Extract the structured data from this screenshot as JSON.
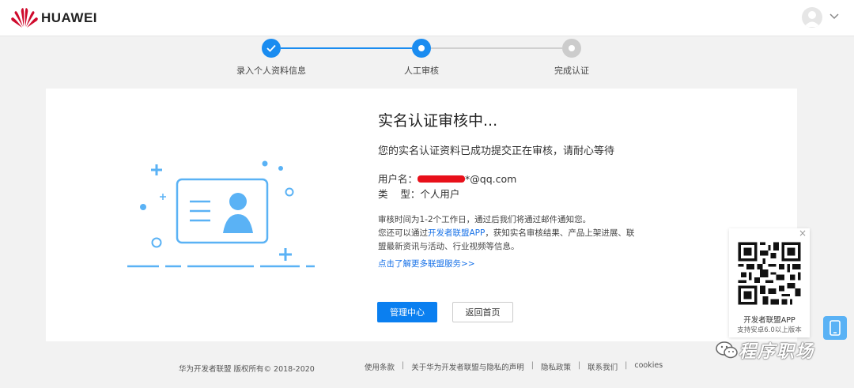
{
  "brand": {
    "name": "HUAWEI",
    "color": "#cf0a2c"
  },
  "header": {
    "user_avatar_icon": "user-avatar-icon",
    "menu_icon": "chevron-down-icon"
  },
  "steps": [
    {
      "label": "录入个人资料信息",
      "status": "done"
    },
    {
      "label": "人工审核",
      "status": "current"
    },
    {
      "label": "完成认证",
      "status": "pending"
    }
  ],
  "colors": {
    "accent": "#0a7ff0",
    "step_active": "#1a8cf0",
    "step_pending": "#cccccc",
    "link": "#1a73e8"
  },
  "review": {
    "title": "实名认证审核中...",
    "subtitle": "您的实名认证资料已成功提交正在审核，请耐心等待",
    "username_label": "用户名：",
    "username_suffix": "*@qq.com",
    "type_label": "类    型：",
    "type_value": "个人用户",
    "note_line1": "审核时间为1-2个工作日，通过后我们将通过邮件通知您。",
    "note_line2_prefix": "您还可以通过",
    "note_line2_link": "开发者联盟APP",
    "note_line2_suffix": "，获知实名审核结果、产品上架进展、联",
    "note_line3": "盟最新资讯与活动、行业视频等信息。",
    "more_link": "点击了解更多联盟服务>>",
    "btn_manage": "管理中心",
    "btn_home": "返回首页"
  },
  "qr_popup": {
    "close": "×",
    "title": "开发者联盟APP",
    "subtitle": "支持安卓6.0以上版本"
  },
  "footer": {
    "copyright": "华为开发者联盟 版权所有© 2018-2020",
    "links": [
      "使用条款",
      "关于华为开发者联盟与隐私的声明",
      "隐私政策",
      "联系我们",
      "cookies"
    ],
    "separator": "|"
  },
  "watermark": {
    "text": "程序职场"
  }
}
